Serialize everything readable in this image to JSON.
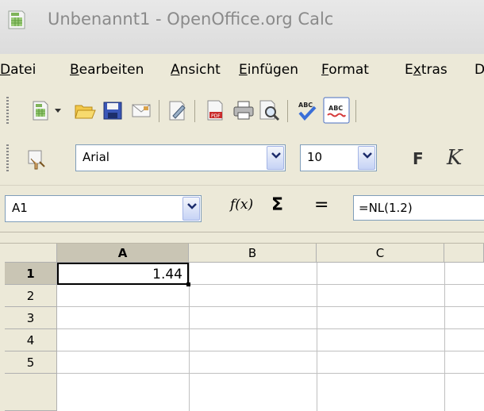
{
  "window": {
    "title": "Unbenannt1 - OpenOffice.org Calc"
  },
  "menu": {
    "items": [
      {
        "acc": "D",
        "rest": "atei"
      },
      {
        "acc": "B",
        "rest": "earbeiten"
      },
      {
        "acc": "A",
        "rest": "nsicht"
      },
      {
        "acc": "E",
        "rest": "infügen"
      },
      {
        "acc": "F",
        "rest": "ormat"
      },
      {
        "acc": "x",
        "pre": "E",
        "rest": "tras"
      },
      {
        "acc": "D",
        "rest": ""
      }
    ]
  },
  "formatting": {
    "font_name": "Arial",
    "font_size": "10",
    "bold_label": "F",
    "italic_label": "K"
  },
  "formula_bar": {
    "name_box": "A1",
    "function_label": "f(x)",
    "sum_label": "Σ",
    "equals_label": "=",
    "formula": "=NL(1.2)"
  },
  "sheet": {
    "columns": [
      "A",
      "B",
      "C"
    ],
    "rows": [
      "1",
      "2",
      "3",
      "4",
      "5"
    ],
    "a1_value": "1.44"
  },
  "colors": {
    "accent": "#7f9db9",
    "selection": "#000000"
  }
}
